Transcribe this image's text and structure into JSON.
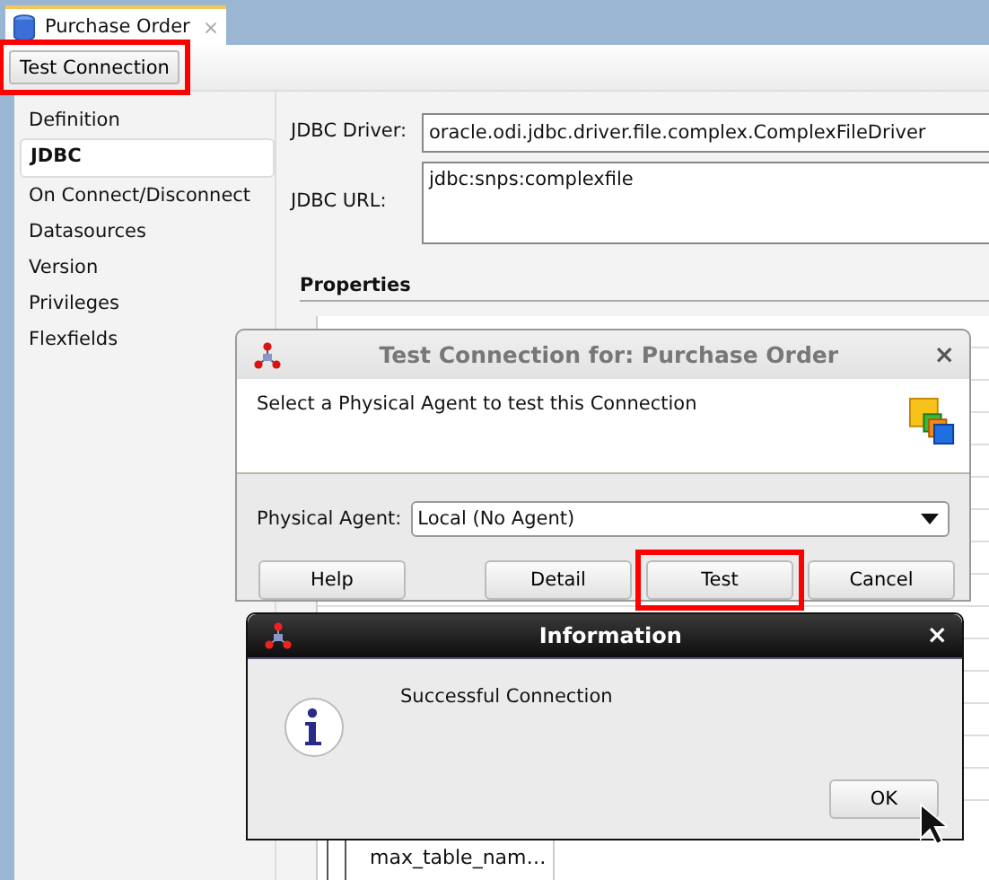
{
  "tab": {
    "title": "Purchase Order",
    "close": "×",
    "selected": true
  },
  "toolbar": {
    "button": {
      "label": "Test Connection",
      "highlighted": true
    }
  },
  "sidebar": {
    "items": [
      {
        "label": "Definition",
        "selected": false
      },
      {
        "label": "JDBC",
        "selected": true
      },
      {
        "label": "On Connect/Disconnect",
        "selected": false
      },
      {
        "label": "Datasources",
        "selected": false
      },
      {
        "label": "Version",
        "selected": false
      },
      {
        "label": "Privileges",
        "selected": false
      },
      {
        "label": "Flexfields",
        "selected": false
      }
    ]
  },
  "form": {
    "driver_label": "JDBC Driver:",
    "driver_value": "oracle.odi.jdbc.driver.file.complex.ComplexFileDriver",
    "url_label": "JDBC URL:",
    "url_value": "jdbc:snps:complexfile",
    "properties_heading": "Properties"
  },
  "properties_tree": {
    "visible_item": "max_table_nam…"
  },
  "test_dialog": {
    "title": "Test Connection for: Purchase Order",
    "close": "×",
    "message": "Select a Physical Agent to test this Connection",
    "agent_label": "Physical Agent:",
    "agent_value": "Local (No Agent)",
    "buttons": [
      {
        "label": "Help",
        "highlighted": false
      },
      {
        "label": "Detail",
        "highlighted": false
      },
      {
        "label": "Test",
        "highlighted": true
      },
      {
        "label": "Cancel",
        "highlighted": false
      }
    ]
  },
  "info_dialog": {
    "title": "Information",
    "close": "×",
    "message": "Successful Connection",
    "button": "OK"
  }
}
